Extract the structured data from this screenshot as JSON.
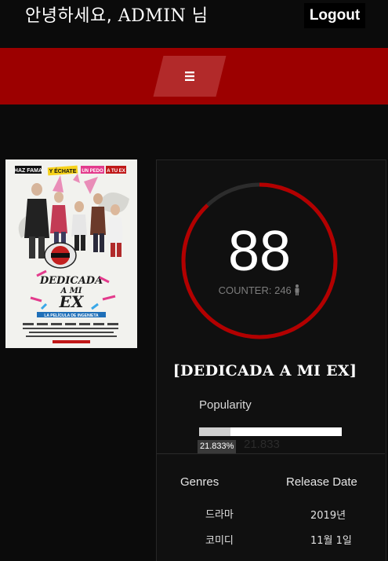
{
  "header": {
    "greeting_prefix": "안녕하세요,",
    "greeting_name": "ADMIN",
    "greeting_suffix": "님",
    "logout_label": "Logout"
  },
  "nav": {
    "menu_icon": "hamburger-icon",
    "accent_color": "#9c0000"
  },
  "poster": {
    "tagline_words": [
      "HAZ FAMA",
      "Y ÉCHATE",
      "UN PEDO",
      "A TU EX"
    ],
    "logo_text": [
      "DEDICADA",
      "A MI",
      "EX"
    ],
    "subtitle": "LA PELÍCULA DE INGENIETA"
  },
  "stats": {
    "score": "88",
    "score_ratio": 0.88,
    "counter_label": "COUNTER:",
    "counter_value": "246",
    "person_icon": "person-icon"
  },
  "movie": {
    "title": "[DEDICADA A MI EX]"
  },
  "popularity": {
    "label": "Popularity",
    "percent": 21.833,
    "badge": "21.833%",
    "value": "21.833"
  },
  "details": {
    "genres_header": "Genres",
    "release_header": "Release Date",
    "genres": [
      "드라마",
      "코미디"
    ],
    "release": [
      "2019년",
      "11월 1일"
    ]
  }
}
